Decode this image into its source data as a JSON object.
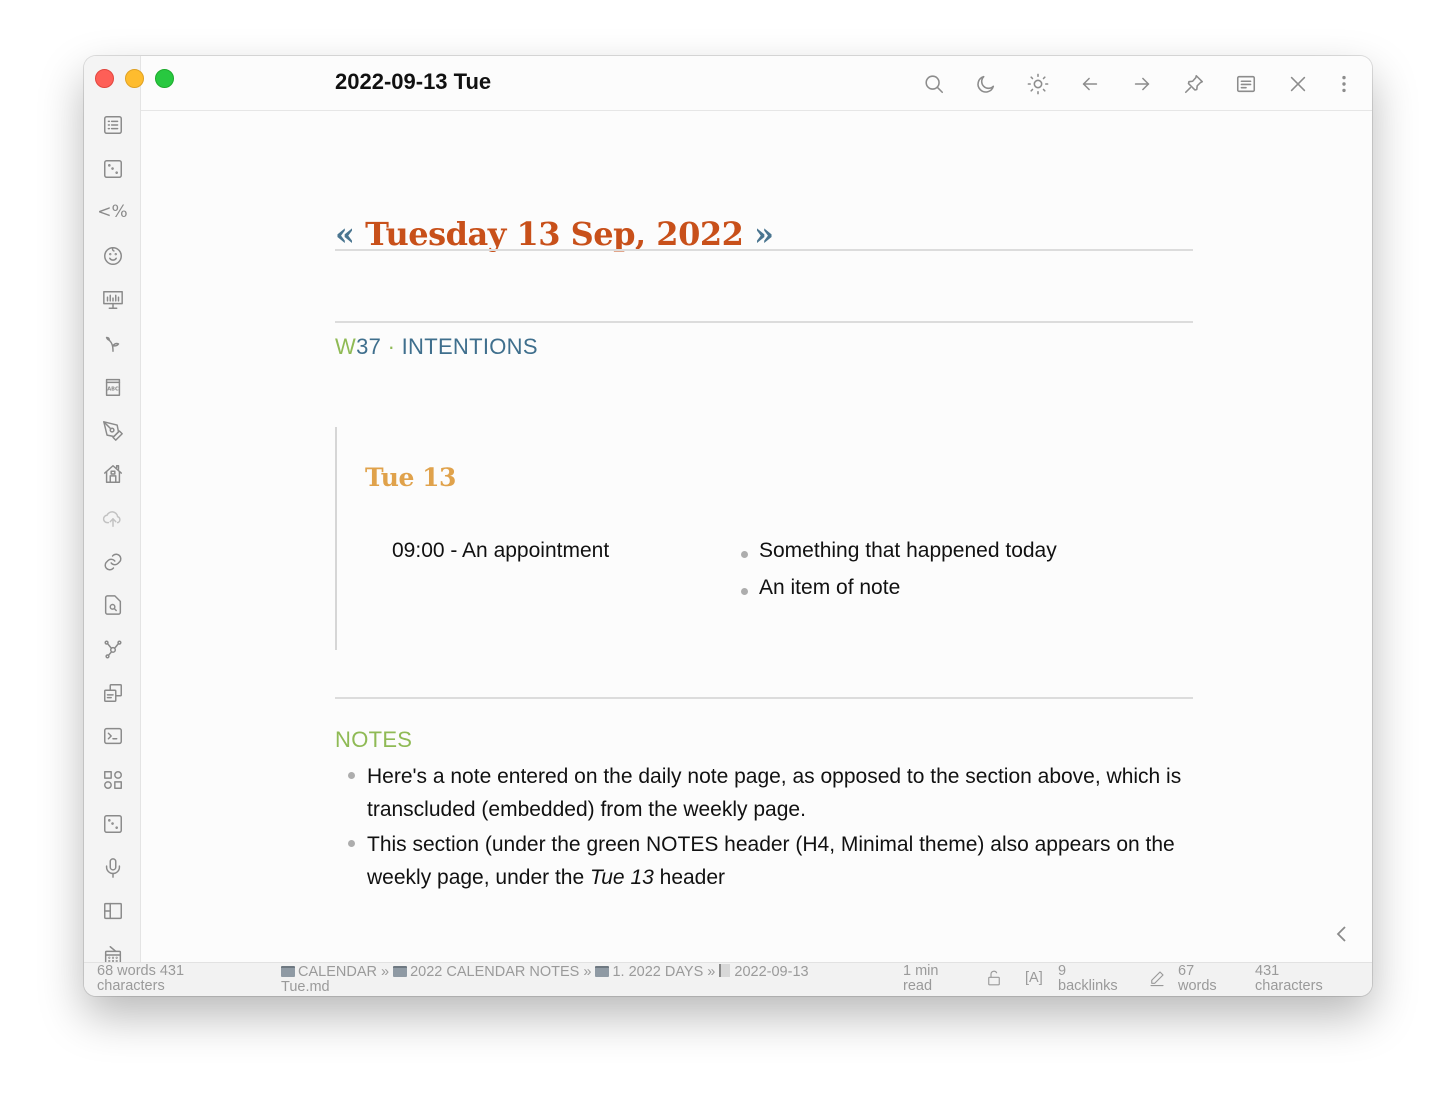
{
  "window": {
    "title": "2022-09-13 Tue",
    "traffic_lights": [
      "close",
      "minimize",
      "maximize"
    ]
  },
  "header_actions": [
    {
      "name": "search-icon",
      "label": "Search"
    },
    {
      "name": "moon-icon",
      "label": "Dark mode"
    },
    {
      "name": "sun-icon",
      "label": "Light mode"
    },
    {
      "name": "arrow-left-icon",
      "label": "Navigate back"
    },
    {
      "name": "arrow-right-icon",
      "label": "Navigate forward"
    },
    {
      "name": "pin-icon",
      "label": "Pin"
    },
    {
      "name": "reading-view-icon",
      "label": "Reading view"
    },
    {
      "name": "close-icon",
      "label": "Close"
    },
    {
      "name": "more-options-icon",
      "label": "More options"
    }
  ],
  "ribbon": {
    "icons": [
      "outline-list-icon",
      "random-note-icon",
      "templater-icon",
      "emoji-icon",
      "presentation-icon",
      "sprout-icon",
      "dictionary-icon",
      "pen-tool-icon",
      "home-icon",
      "cloud-upload-icon",
      "link-icon",
      "file-search-icon",
      "graph-icon",
      "copy-icon",
      "terminal-icon",
      "apps-grid-icon",
      "random-note-icon-2",
      "microphone-icon",
      "layout-icon",
      "calendar-icon"
    ],
    "templater_text": "<%"
  },
  "note": {
    "date_title": {
      "prev": "«",
      "text": "Tuesday 13 Sep, 2022",
      "next": "»"
    },
    "week_heading": {
      "w": "W",
      "num": "37",
      "sep": " · ",
      "label": "INTENTIONS"
    },
    "embed": {
      "title": "Tue 13",
      "appointment": "09:00 - An appointment",
      "items": [
        "Something that happened today",
        "An item of note"
      ]
    },
    "notes_heading": "NOTES",
    "notes": [
      {
        "text": "Here's a note entered on the daily note page, as opposed to the section above, which is transcluded (embedded) from the weekly page."
      },
      {
        "before": "This section (under the green NOTES header (H4, Minimal theme) also appears on the weekly page, under the ",
        "italic": "Tue 13",
        "after": " header"
      }
    ]
  },
  "colors": {
    "date_title": "#c8501a",
    "nav_arrows": "#4a7590",
    "week_heading": "#3f6f8d",
    "green_accent": "#8fba55",
    "embed_title": "#e0a24b"
  },
  "statusbar": {
    "word_count_line1": "68 words 431",
    "word_count_line2": "characters",
    "breadcrumb": [
      "CALENDAR",
      "2022 CALENDAR NOTES",
      "1. 2022 DAYS",
      "2022-09-13"
    ],
    "breadcrumb_sep": " » ",
    "breadcrumb_tail": "Tue.md",
    "read_time_line1": "1 min",
    "read_time_line2": "read",
    "lang": "[A]",
    "backlinks_count": "9",
    "backlinks_label": "backlinks",
    "words_count": "67",
    "words_label": "words",
    "chars_count": "431",
    "chars_label": "characters"
  }
}
